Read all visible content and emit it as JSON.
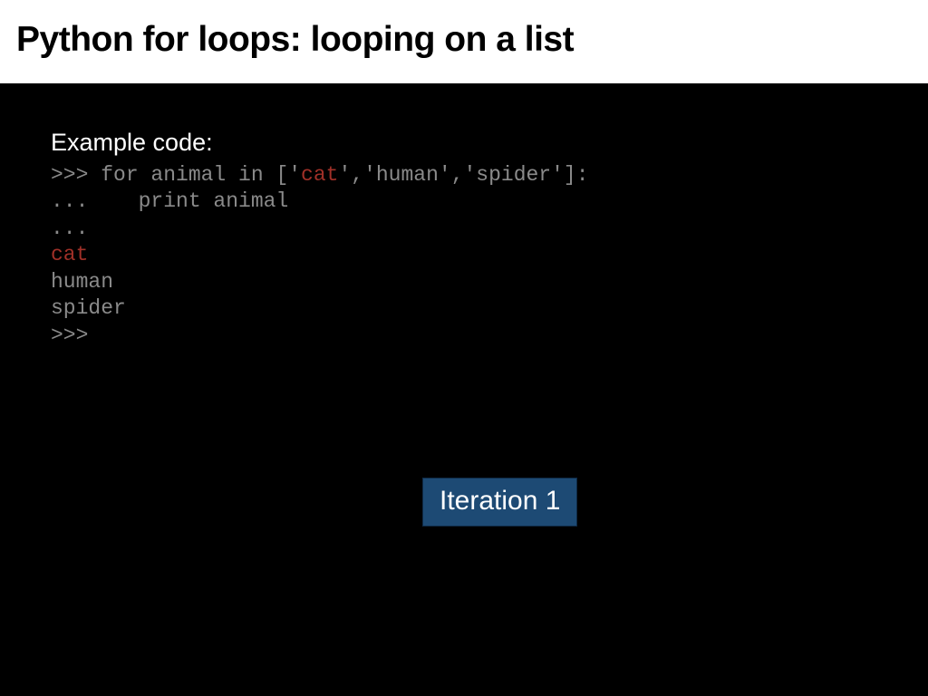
{
  "title": "Python for loops: looping on a list",
  "example_label": "Example code:",
  "code": {
    "line1_pre": ">>> for animal in ['",
    "line1_hl": "cat",
    "line1_post": "','human','spider']:",
    "line2": "...    print animal",
    "line3": "...",
    "line4_hl": "cat",
    "line5": "human",
    "line6": "spider",
    "line7": ">>>"
  },
  "iteration_label": "Iteration 1"
}
